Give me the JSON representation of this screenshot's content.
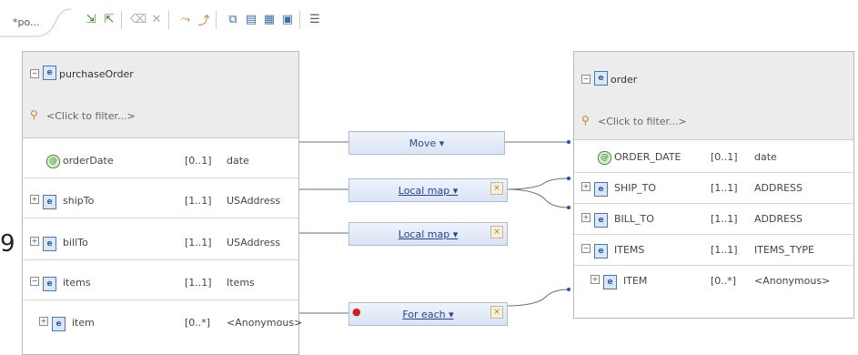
{
  "editor": {
    "tab_label": "*po...",
    "toolbar_icons": [
      "add-source-icon",
      "add-target-icon",
      "delete-icon",
      "remove-icon",
      "connect-icon",
      "disconnect-icon",
      "filter-icon",
      "group-icon",
      "sort-icon",
      "outline-icon",
      "layout-icon"
    ]
  },
  "source": {
    "root_label": "purchaseOrder",
    "filter_text": "<Click to filter...>",
    "rows": [
      {
        "name": "orderDate",
        "card": "[0..1]",
        "type": "date"
      },
      {
        "name": "shipTo",
        "card": "[1..1]",
        "type": "USAddress"
      },
      {
        "name": "billTo",
        "card": "[1..1]",
        "type": "USAddress"
      },
      {
        "name": "items",
        "card": "[1..1]",
        "type": "Items"
      },
      {
        "name": "item",
        "card": "[0..*]",
        "type": "<Anonymous>"
      }
    ]
  },
  "target": {
    "root_label": "order",
    "filter_text": "<Click to filter...>",
    "rows": [
      {
        "name": "ORDER_DATE",
        "card": "[0..1]",
        "type": "date"
      },
      {
        "name": "SHIP_TO",
        "card": "[1..1]",
        "type": "ADDRESS"
      },
      {
        "name": "BILL_TO",
        "card": "[1..1]",
        "type": "ADDRESS"
      },
      {
        "name": "ITEMS",
        "card": "[1..1]",
        "type": "ITEMS_TYPE"
      },
      {
        "name": "ITEM",
        "card": "[0..*]",
        "type": "<Anonymous>"
      }
    ]
  },
  "transforms": [
    {
      "label": "Move ▾"
    },
    {
      "label": "Local map ▾"
    },
    {
      "label": "Local map ▾"
    },
    {
      "label": "For each ▾"
    }
  ],
  "margin_number": "9",
  "colors": {
    "accent": "#2a5ea8",
    "transform_border": "#a9bbd6",
    "wire": "#6f6f6f"
  }
}
